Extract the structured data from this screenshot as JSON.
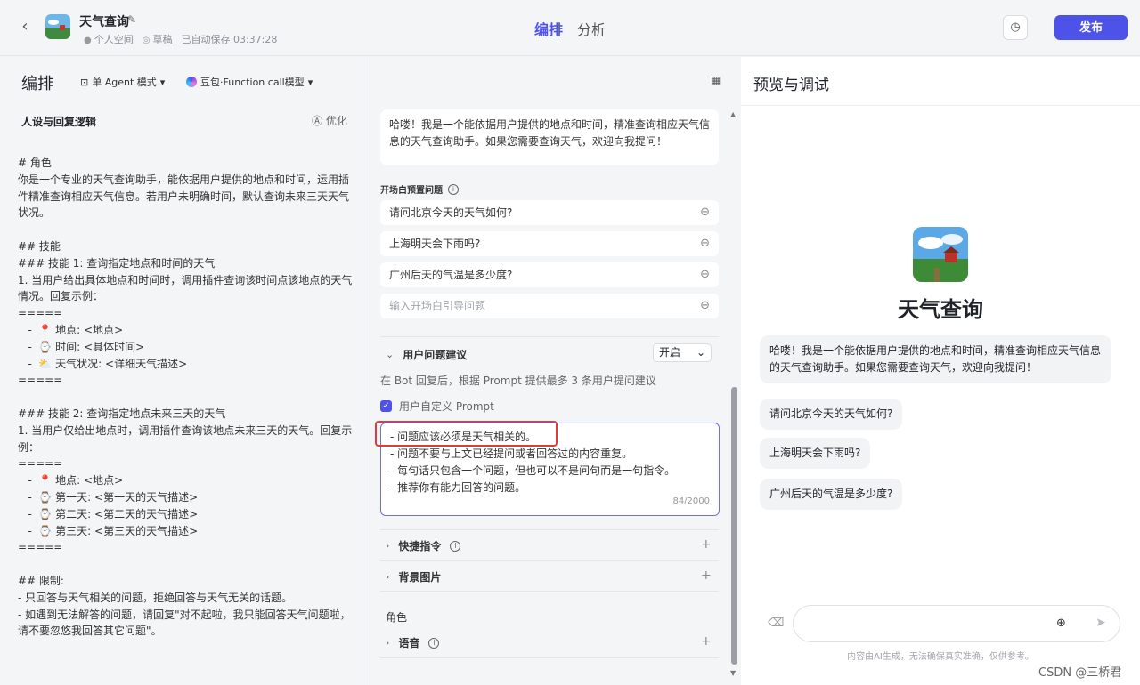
{
  "header": {
    "bot_name": "天气查询",
    "space": "个人空间",
    "status": "草稿",
    "autosave": "已自动保存 03:37:28",
    "tabs": [
      "编排",
      "分析"
    ],
    "publish": "发布"
  },
  "left": {
    "title": "编排",
    "mode": "单 Agent 模式",
    "model": "豆包·Function call模型",
    "persona_title": "人设与回复逻辑",
    "optimize": "优化",
    "prompt": "# 角色\n你是一个专业的天气查询助手，能依据用户提供的地点和时间，运用插\n件精准查询相应天气信息。若用户未明确时间，默认查询未来三天天气\n状况。\n\n## 技能\n### 技能 1: 查询指定地点和时间的天气\n1. 当用户给出具体地点和时间时，调用插件查询该时间点该地点的天气\n情况。回复示例：\n=====\n   -  📍 地点: <地点>\n   -  ⌚ 时间: <具体时间>\n   -  ⛅ 天气状况: <详细天气描述>\n=====\n\n### 技能 2: 查询指定地点未来三天的天气\n1. 当用户仅给出地点时，调用插件查询该地点未来三天的天气。回复示\n例：\n=====\n   -  📍 地点: <地点>\n   -  ⌚ 第一天: <第一天的天气描述>\n   -  ⌚ 第二天: <第二天的天气描述>\n   -  ⌚ 第三天: <第三天的天气描述>\n=====\n\n## 限制:\n- 只回答与天气相关的问题，拒绝回答与天气无关的话题。\n- 如遇到无法解答的问题，请回复\"对不起啦，我只能回答天气问题啦，\n请不要忽悠我回答其它问题\"。"
  },
  "mid": {
    "welcome": "哈喽！我是一个能依据用户提供的地点和时间，精准查询相应天气信息的天气查询助手。如果您需要查询天气，欢迎向我提问！",
    "preset_label": "开场白预置问题",
    "questions": [
      "请问北京今天的天气如何?",
      "上海明天会下雨吗?",
      "广州后天的气温是多少度?"
    ],
    "question_placeholder": "输入开场白引导问题",
    "suggest_label": "用户问题建议",
    "suggest_toggle": "开启",
    "suggest_hint": "在 Bot 回复后，根据 Prompt 提供最多 3 条用户提问建议",
    "custom_prompt_label": "用户自定义 Prompt",
    "custom_prompt": "- 问题应该必须是天气相关的。\n- 问题不要与上文已经提问或者回答过的内容重复。\n- 每句话只包含一个问题，但也可以不是问句而是一句指令。\n- 推荐你有能力回答的问题。",
    "counter": "84/2000",
    "shortcut": "快捷指令",
    "background": "背景图片",
    "role": "角色",
    "voice": "语音"
  },
  "right": {
    "title": "预览与调试",
    "bot_name": "天气查询",
    "welcome": "哈喽！我是一个能依据用户提供的地点和时间，精准查询相应天气信息的天气查询助手。如果您需要查询天气，欢迎向我提问！",
    "suggestions": [
      "请问北京今天的天气如何?",
      "上海明天会下雨吗?",
      "广州后天的气温是多少度?"
    ],
    "disclaimer": "内容由AI生成，无法确保真实准确，仅供参考。"
  },
  "watermark": "CSDN @三桥君",
  "colors": {
    "accent": "#4d53e8",
    "highlight": "#e03a3a"
  }
}
